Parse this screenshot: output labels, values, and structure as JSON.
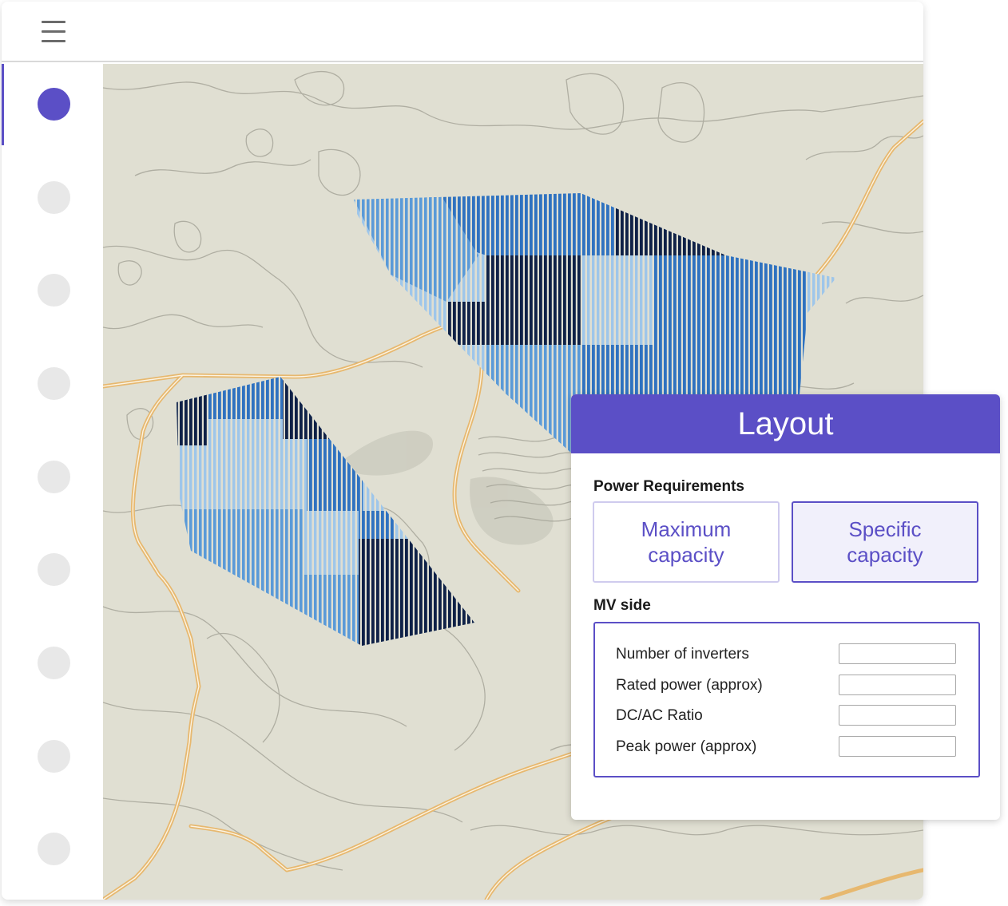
{
  "sidebar": {
    "steps": 9,
    "active_step": 1
  },
  "panel": {
    "title": "Layout",
    "power_requirements": {
      "label": "Power Requirements",
      "options": [
        "Maximum capacity",
        "Specific capacity"
      ],
      "selected": "Specific capacity"
    },
    "mv_side": {
      "label": "MV side",
      "fields": [
        {
          "label": "Number of inverters",
          "value": ""
        },
        {
          "label": "Rated power (approx)",
          "value": ""
        },
        {
          "label": "DC/AC Ratio",
          "value": ""
        },
        {
          "label": "Peak power (approx)",
          "value": ""
        }
      ]
    }
  },
  "colors": {
    "accent": "#5b4fc6",
    "map_background": "#e0dfd2",
    "road": "#e7b86f",
    "array_light": "#9ec6ea",
    "array_mid": "#5a9ad8",
    "array_blue": "#2f72c0",
    "array_dark": "#0f2147"
  },
  "icons": {
    "menu": "hamburger-menu-icon"
  }
}
